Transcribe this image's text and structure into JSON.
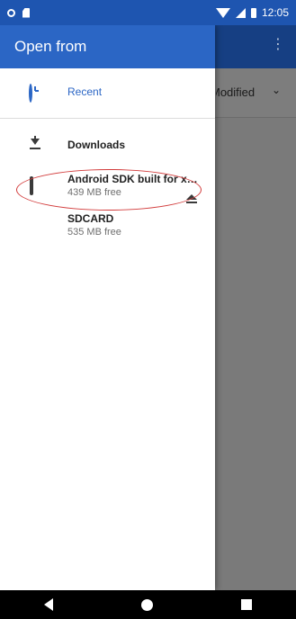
{
  "status_bar": {
    "time": "12:05"
  },
  "app": {
    "menu_glyph": "⋮",
    "sort_label": "Modified",
    "sort_chevron": "⌄"
  },
  "drawer": {
    "title": "Open from",
    "items": [
      {
        "label": "Recent",
        "icon": "clock-icon"
      },
      {
        "label": "Downloads",
        "icon": "download-icon"
      },
      {
        "label": "Android SDK built for x…",
        "sub": "439 MB free",
        "icon": "phone-icon"
      },
      {
        "label": "SDCARD",
        "sub": "535 MB free",
        "icon": "sdcard-icon",
        "action_icon": "eject-icon"
      }
    ]
  },
  "colors": {
    "status_bar": "#1e55b0",
    "drawer_header": "#2b66c5",
    "accent": "#2b66c5",
    "highlight": "#d23b3b"
  }
}
